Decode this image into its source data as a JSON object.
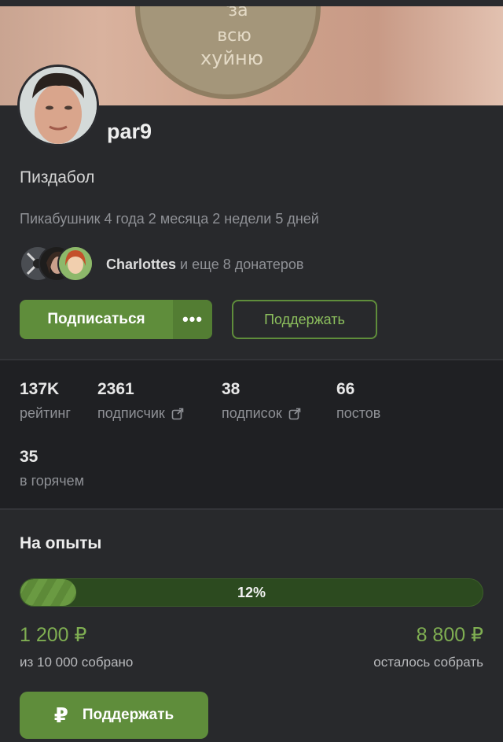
{
  "profile": {
    "username": "par9",
    "status": "Пиздабол",
    "since": "Пикабушник 4 года 2 месяца 2 недели 5 дней",
    "cover_text": [
      "за",
      "всю",
      "хуйню"
    ]
  },
  "donors": {
    "name": "Charlottes",
    "rest": " и еще 8 донатеров"
  },
  "actions": {
    "subscribe_label": "Подписаться",
    "more_label": "•••",
    "support_label": "Поддержать"
  },
  "stats": [
    {
      "value": "137K",
      "label": "рейтинг"
    },
    {
      "value": "2361",
      "label": "подписчик"
    },
    {
      "value": "38",
      "label": "подписок"
    },
    {
      "value": "66",
      "label": "постов"
    },
    {
      "value": "35",
      "label": "в горячем"
    }
  ],
  "goal": {
    "title": "На опыты",
    "progress_label": "12%",
    "progress_fraction": 0.12,
    "collected": "1 200 ₽",
    "collected_label": "из 10 000 собрано",
    "remaining": "8 800 ₽",
    "remaining_label": "осталось собрать",
    "support_label": "Поддержать",
    "support_icon": "₽"
  },
  "colors": {
    "background": "#1f2023",
    "card": "#28292c",
    "accent": "#5f8d3b",
    "accent_text": "#7fae52"
  },
  "icons": [
    "external-link-icon",
    "ruble-icon",
    "more-dots-icon"
  ]
}
